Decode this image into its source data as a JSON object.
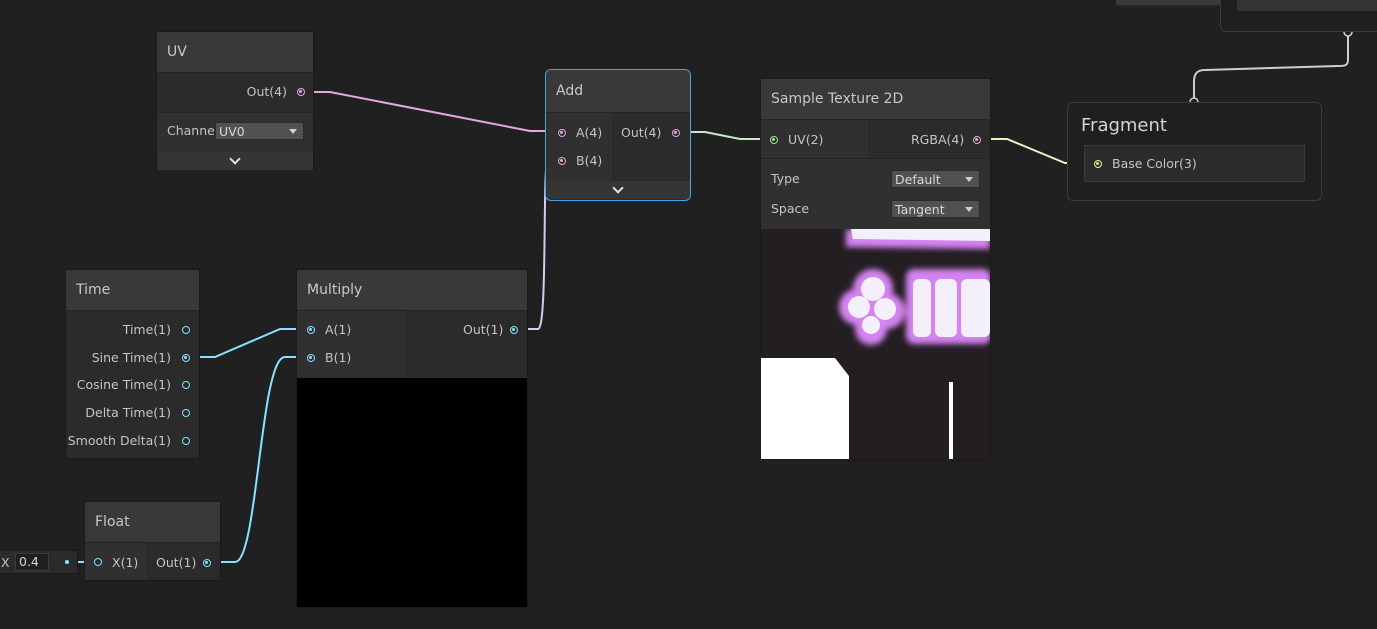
{
  "nodes": {
    "uv": {
      "title": "UV",
      "out": "Out(4)",
      "channel_label": "Channe",
      "channel_value": "UV0"
    },
    "add": {
      "title": "Add",
      "in_a": "A(4)",
      "in_b": "B(4)",
      "out": "Out(4)"
    },
    "sample": {
      "title": "Sample Texture 2D",
      "in_uv": "UV(2)",
      "out": "RGBA(4)",
      "type_label": "Type",
      "type_value": "Default",
      "space_label": "Space",
      "space_value": "Tangent"
    },
    "fragment": {
      "title": "Fragment",
      "base_color": "Base Color(3)"
    },
    "time": {
      "title": "Time",
      "outputs": [
        "Time(1)",
        "Sine Time(1)",
        "Cosine Time(1)",
        "Delta Time(1)",
        "Smooth Delta(1)"
      ]
    },
    "multiply": {
      "title": "Multiply",
      "in_a": "A(1)",
      "in_b": "B(1)",
      "out": "Out(1)"
    },
    "float": {
      "title": "Float",
      "in_x": "X(1)",
      "out": "Out(1)",
      "field_label": "X",
      "field_value": "0.4"
    }
  },
  "colors": {
    "vector4": "#e5a8dd",
    "vector1": "#84e4ff",
    "vector2": "#9ae68f",
    "vector3": "#f0f28c",
    "selection": "#44a8e0"
  }
}
